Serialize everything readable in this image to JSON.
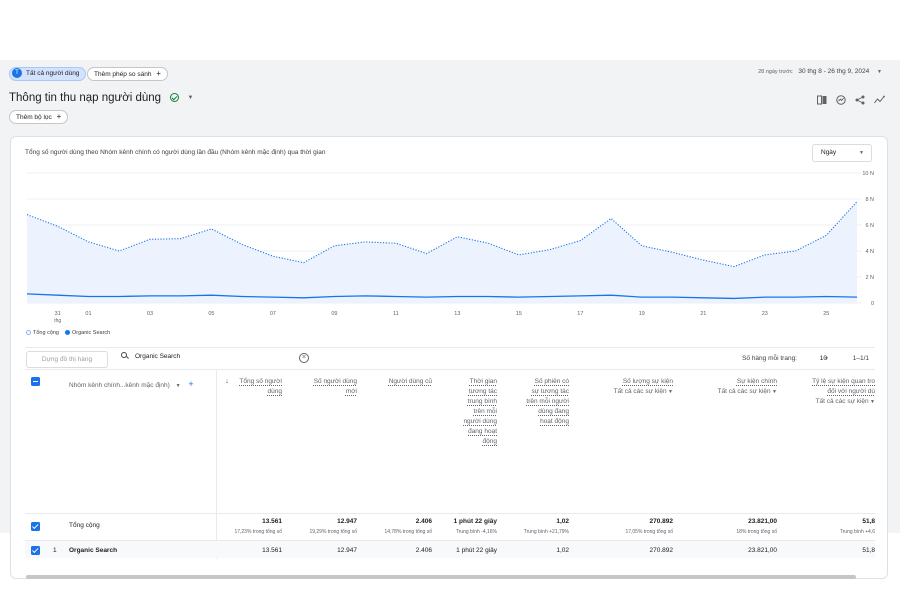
{
  "top": {
    "segment_avatar": "T",
    "segment_chip": "Tất cả người dùng",
    "compare_chip": "Thêm phép so sánh",
    "date_label": "28 ngày trước",
    "date_range": "30 thg 8 - 26 thg 9, 2024"
  },
  "header": {
    "title": "Thông tin thu nạp người dùng",
    "filter_chip": "Thêm bộ lọc"
  },
  "chart": {
    "title": "Tổng số người dùng theo Nhóm kênh chính có người dùng lần đầu (Nhóm kênh mặc định) qua thời gian",
    "granularity": "Ngày",
    "legend": [
      {
        "label": "Tổng cộng",
        "color": "#8ab4f8"
      },
      {
        "label": "Organic Search",
        "color": "#1a73e8"
      }
    ]
  },
  "chart_data": {
    "type": "line",
    "y_ticks": [
      "10 N",
      "8 N",
      "6 N",
      "4 N",
      "2 N",
      "0"
    ],
    "ylim": [
      0,
      10000
    ],
    "x_ticks": [
      {
        "label": "31",
        "sub": "thg",
        "day_index": 1
      },
      {
        "label": "01",
        "sub": "",
        "day_index": 2
      },
      {
        "label": "03",
        "sub": "",
        "day_index": 4
      },
      {
        "label": "05",
        "sub": "",
        "day_index": 6
      },
      {
        "label": "07",
        "sub": "",
        "day_index": 8
      },
      {
        "label": "09",
        "sub": "",
        "day_index": 10
      },
      {
        "label": "11",
        "sub": "",
        "day_index": 12
      },
      {
        "label": "13",
        "sub": "",
        "day_index": 14
      },
      {
        "label": "15",
        "sub": "",
        "day_index": 16
      },
      {
        "label": "17",
        "sub": "",
        "day_index": 18
      },
      {
        "label": "19",
        "sub": "",
        "day_index": 20
      },
      {
        "label": "21",
        "sub": "",
        "day_index": 22
      },
      {
        "label": "23",
        "sub": "",
        "day_index": 24
      },
      {
        "label": "25",
        "sub": "",
        "day_index": 26
      }
    ],
    "series": [
      {
        "name": "Tổng cộng",
        "style": "dotted",
        "color": "#1a73e8",
        "values": [
          6800,
          5900,
          4700,
          4000,
          4900,
          4950,
          5700,
          4500,
          3600,
          3100,
          4400,
          4700,
          4600,
          3800,
          5100,
          4600,
          3700,
          4100,
          4800,
          6500,
          4400,
          3900,
          3300,
          2800,
          3700,
          4000,
          5200,
          7800
        ]
      },
      {
        "name": "Organic Search",
        "style": "solid",
        "color": "#1a73e8",
        "values": [
          700,
          600,
          500,
          500,
          550,
          550,
          600,
          500,
          450,
          400,
          500,
          550,
          500,
          450,
          500,
          500,
          450,
          500,
          550,
          600,
          450,
          450,
          400,
          350,
          450,
          450,
          500,
          450
        ]
      }
    ]
  },
  "table": {
    "search_btn": "Dựng đồ thị hàng",
    "search_value": "Organic Search",
    "rows_per_page_label": "Số hàng mỗi trang:",
    "rows_per_page": "10",
    "pager": "1–1/1",
    "dim_header": "Nhóm kênh chính...kênh mặc định)",
    "headers": [
      {
        "lines": [
          "Tổng số người",
          "dùng"
        ],
        "sort": "↓"
      },
      {
        "lines": [
          "Số người dùng",
          "mới"
        ]
      },
      {
        "lines": [
          "Người dùng cũ"
        ]
      },
      {
        "lines": [
          "Thời gian",
          "tương tác",
          "trung bình",
          "trên mỗi",
          "người dùng",
          "đang hoạt",
          "động"
        ]
      },
      {
        "lines": [
          "Số phiên có",
          "sự tương tác",
          "trên mỗi người",
          "dùng đang",
          "hoạt động"
        ]
      },
      {
        "lines": [
          "Số lượng sự kiện"
        ],
        "sub": "Tất cả các sự kiện"
      },
      {
        "lines": [
          "Sự kiện chính"
        ],
        "sub": "Tất cả các sự kiện"
      },
      {
        "lines": [
          "Tỷ lệ sự kiện quan tro",
          "đối với người dù"
        ],
        "sub": "Tất cả các sự kiện"
      }
    ],
    "total_label": "Tổng cộng",
    "totals": [
      "13.561",
      "12.947",
      "2.406",
      "1 phút 22 giây",
      "1,02",
      "270.892",
      "23.821,00",
      "51,8"
    ],
    "totals_sub": [
      "17,23% trong tổng số",
      "19,29% trong tổng số",
      "14,78% trong tổng số",
      "Trung bình -4,16%",
      "Trung bình +21,79%",
      "17,05% trong tổng số",
      "18% trong tổng số",
      "Trung bình +4,6"
    ],
    "row_index": "1",
    "row_label": "Organic Search",
    "row": [
      "13.561",
      "12.947",
      "2.406",
      "1 phút 22 giây",
      "1,02",
      "270.892",
      "23.821,00",
      "51,8"
    ]
  }
}
